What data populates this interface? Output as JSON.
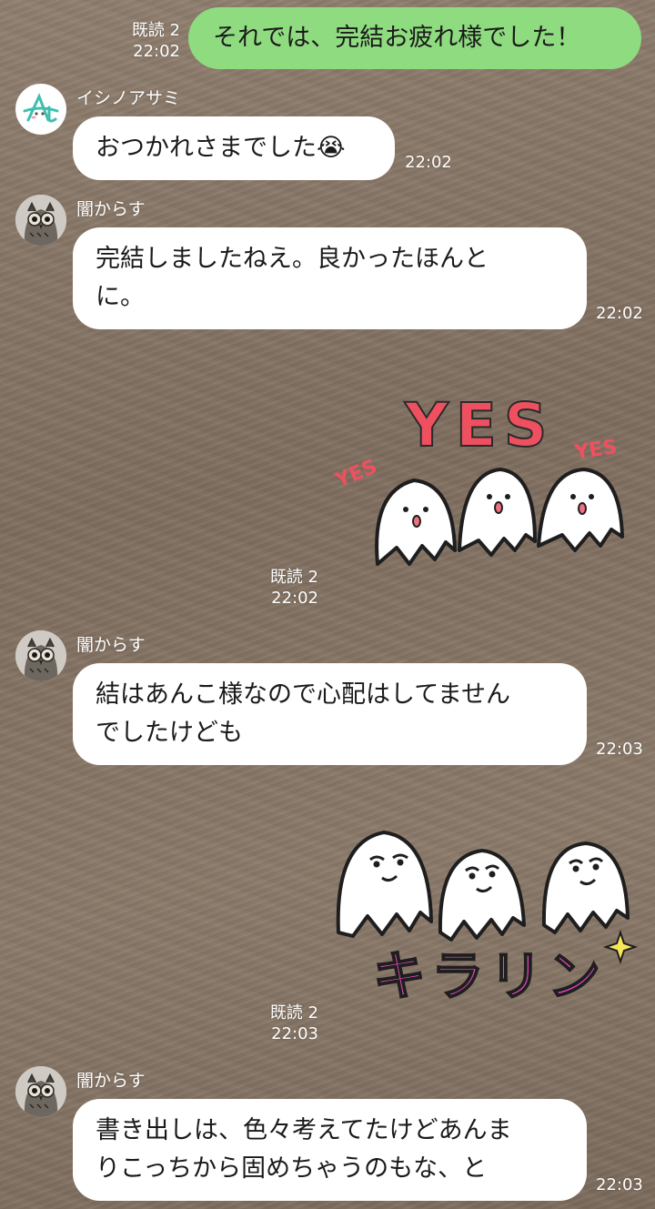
{
  "messages": [
    {
      "id": "m1",
      "side": "me",
      "text": "それでは、完結お疲れ様でした！",
      "read": "既読 2",
      "time": "22:02"
    },
    {
      "id": "m2",
      "side": "other",
      "sender": "イシノアサミ",
      "lines": [
        "おつかれさまでした😭"
      ],
      "time": "22:02"
    },
    {
      "id": "m3",
      "side": "other",
      "sender": "闇からす",
      "lines": [
        "完結しましたねえ。良かったほんと",
        "に。"
      ],
      "time": "22:02"
    },
    {
      "id": "m4",
      "side": "me",
      "sticker": "yes",
      "sticker_text": {
        "main": "YES",
        "small_left": "YES",
        "small_right": "YES"
      },
      "read": "既読 2",
      "time": "22:02"
    },
    {
      "id": "m5",
      "side": "other",
      "sender": "闇からす",
      "lines": [
        "結はあんこ様なので心配はしてません",
        "でしたけども"
      ],
      "time": "22:03"
    },
    {
      "id": "m6",
      "side": "me",
      "sticker": "kirarin",
      "sticker_text": {
        "main": "キラリン"
      },
      "read": "既読 2",
      "time": "22:03"
    },
    {
      "id": "m7",
      "side": "other",
      "sender": "闇からす",
      "lines": [
        "書き出しは、色々考えてたけどあんま",
        "りこっちから固めちゃうのもな、と"
      ],
      "time": "22:03"
    }
  ],
  "colors": {
    "my_bubble": "#8fdb80",
    "their_bubble": "#ffffff",
    "sticker_red": "#ef5060",
    "sticker_pink": "#f24bc8"
  },
  "icons": {
    "avatar_asami": "letter-a-avatar",
    "avatar_karasu": "owl-avatar"
  }
}
